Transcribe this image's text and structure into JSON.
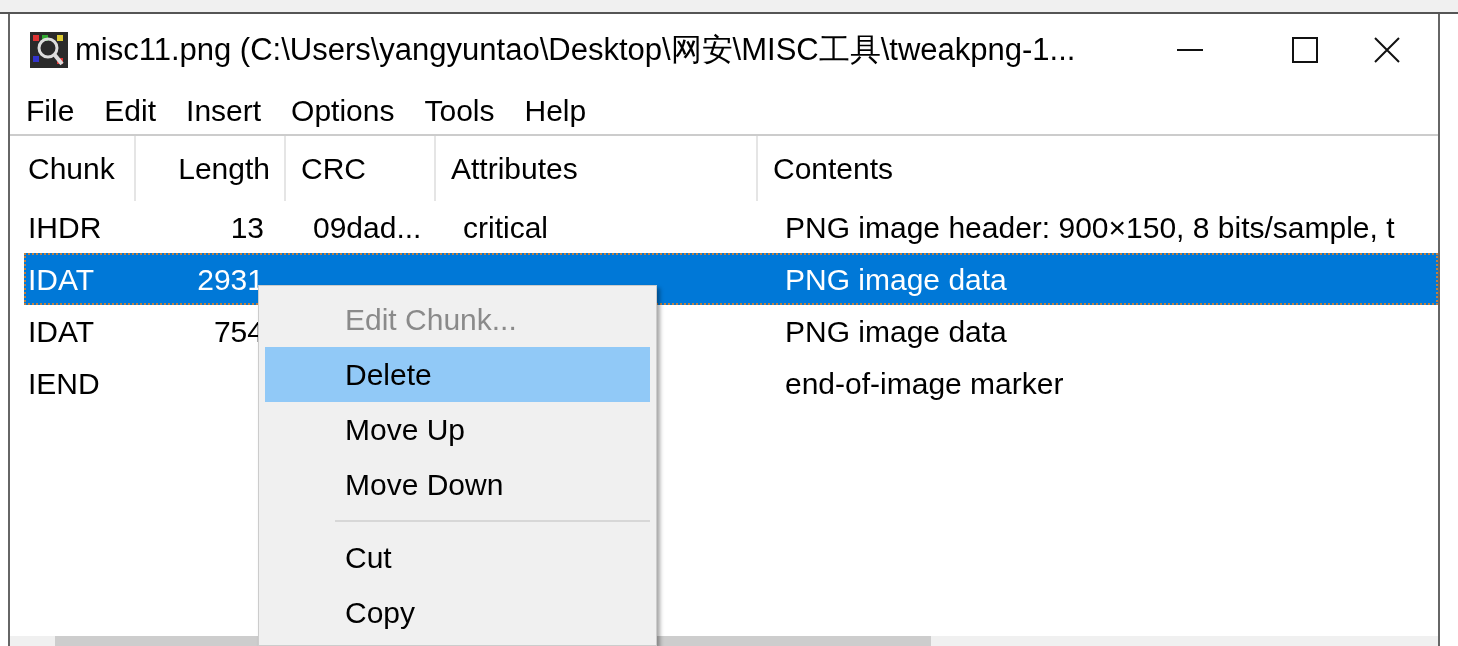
{
  "window": {
    "title": "misc11.png (C:\\Users\\yangyuntao\\Desktop\\网安\\MISC工具\\tweakpng-1..."
  },
  "menu_bar": [
    "File",
    "Edit",
    "Insert",
    "Options",
    "Tools",
    "Help"
  ],
  "table": {
    "columns": [
      "Chunk",
      "Length",
      "CRC",
      "Attributes",
      "Contents"
    ],
    "rows": [
      {
        "chunk": "IHDR",
        "length": "13",
        "crc": "09dad...",
        "attributes": "critical",
        "contents": "PNG image header: 900×150, 8 bits/sample, t",
        "selected": false
      },
      {
        "chunk": "IDAT",
        "length": "2931",
        "contents": "PNG image data",
        "selected": true
      },
      {
        "chunk": "IDAT",
        "length": "754",
        "contents": "PNG image data",
        "selected": false
      },
      {
        "chunk": "IEND",
        "contents": "end-of-image marker",
        "selected": false
      }
    ]
  },
  "context_menu": [
    {
      "kind": "item",
      "label": "Edit Chunk...",
      "disabled": true,
      "selected": false
    },
    {
      "kind": "item",
      "label": "Delete",
      "disabled": false,
      "selected": true
    },
    {
      "kind": "item",
      "label": "Move Up",
      "disabled": false,
      "selected": false
    },
    {
      "kind": "item",
      "label": "Move Down",
      "disabled": false,
      "selected": false
    },
    {
      "kind": "separator"
    },
    {
      "kind": "item",
      "label": "Cut",
      "disabled": false,
      "selected": false
    },
    {
      "kind": "item",
      "label": "Copy",
      "disabled": false,
      "selected": false
    }
  ]
}
